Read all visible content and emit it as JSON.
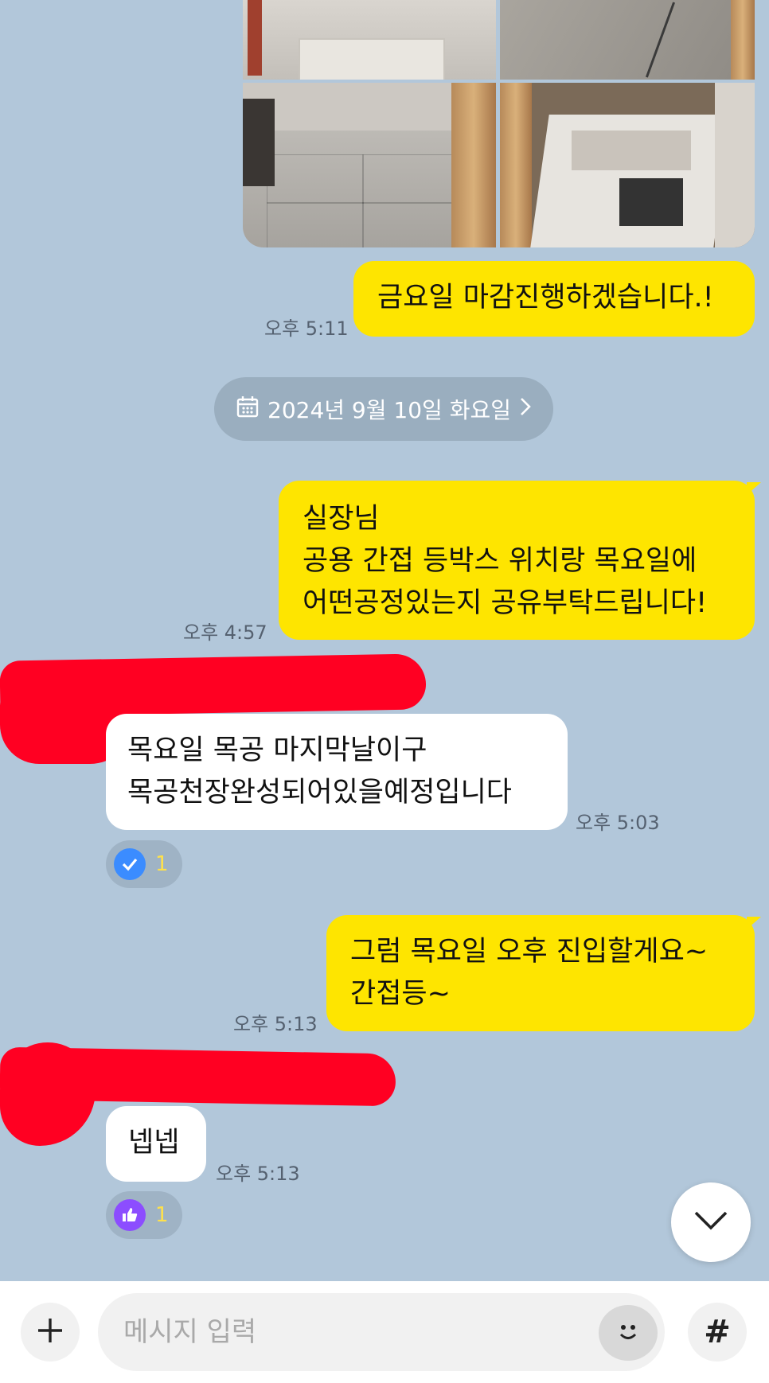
{
  "photos": {
    "count": 4
  },
  "messages": [
    {
      "id": "m1",
      "side": "right",
      "text": "금요일 마감진행하겠습니다.!",
      "time": "오후 5:11"
    },
    {
      "id": "m2",
      "side": "right",
      "text": "실장님\n공용 간접 등박스 위치랑 목요일에\n어떤공정있는지 공유부탁드립니다!",
      "time": "오후 4:57"
    },
    {
      "id": "m3",
      "side": "left",
      "text": "목요일 목공 마지막날이구\n목공천장완성되어있을예정입니다",
      "time": "오후 5:03",
      "reaction": {
        "icon": "check-icon",
        "count": "1",
        "color": "#3b8cff"
      }
    },
    {
      "id": "m4",
      "side": "right",
      "text": "그럼 목요일 오후 진입할게요~\n간접등~",
      "time": "오후 5:13"
    },
    {
      "id": "m5",
      "side": "left",
      "text": "넵넵",
      "time": "오후 5:13",
      "reaction": {
        "icon": "thumbs-up-icon",
        "count": "1",
        "color": "#8c4dff"
      }
    }
  ],
  "date_divider": {
    "label": "2024년 9월 10일 화요일",
    "icon": "calendar-icon",
    "chevron": "chevron-right-icon"
  },
  "composer": {
    "placeholder": "메시지 입력",
    "add_icon": "plus-icon",
    "emoji_icon": "emoji-icon",
    "hashtag_icon": "hashtag-icon",
    "hashtag_glyph": "#"
  },
  "colors": {
    "background": "#b2c7da",
    "my_bubble": "#fee500",
    "their_bubble": "#ffffff",
    "redaction": "#ff0022"
  }
}
